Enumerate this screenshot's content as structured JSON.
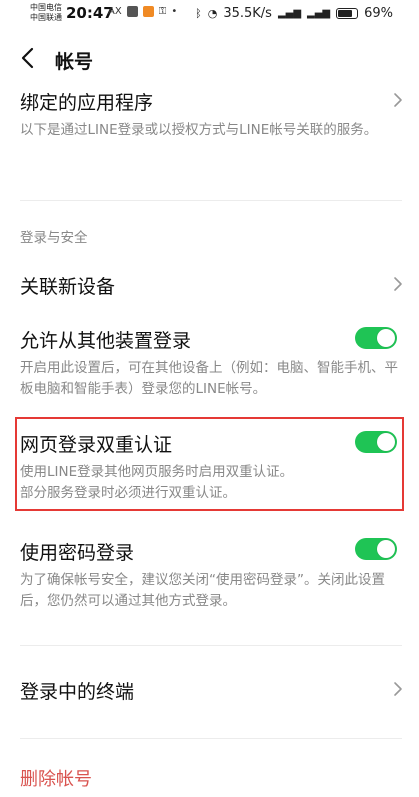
{
  "status_bar": {
    "carrier_1": "中国电信",
    "carrier_2": "中国联通",
    "time": "20:47",
    "ax": "AX",
    "speed": "35.5K/s",
    "battery": "69%"
  },
  "header": {
    "title": "帐号"
  },
  "bound_apps": {
    "title": "绑定的应用程序",
    "description": "以下是通过LINE登录或以授权方式与LINE帐号关联的服务。"
  },
  "section_login_security": "登录与安全",
  "link_device": {
    "title": "关联新设备"
  },
  "allow_other_devices": {
    "title": "允许从其他装置登录",
    "enabled": true,
    "description": "开启用此设置后，可在其他设备上（例如：电脑、智能手机、平板电脑和智能手表）登录您的LINE帐号。"
  },
  "web_2fa": {
    "title": "网页登录双重认证",
    "enabled": true,
    "description_1": "使用LINE登录其他网页服务时启用双重认证。",
    "description_2": "部分服务登录时必须进行双重认证。"
  },
  "password_login": {
    "title": "使用密码登录",
    "enabled": true,
    "description": "为了确保帐号安全，建议您关闭“使用密码登录”。关闭此设置后，您仍然可以通过其他方式登录。"
  },
  "active_sessions": {
    "title": "登录中的终端"
  },
  "delete_account": "删除帐号",
  "colors": {
    "toggle_on": "#1fc455",
    "highlight": "#e53935",
    "danger": "#d9534f"
  }
}
